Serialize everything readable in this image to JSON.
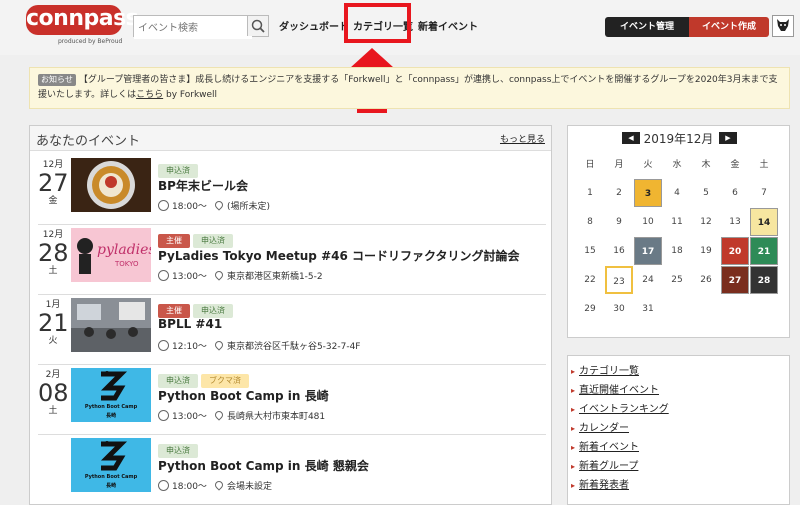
{
  "header": {
    "logo_text": "connpass",
    "logo_sub": "produced by BeProud",
    "search_placeholder": "イベント検索",
    "nav": [
      "ダッシュボード",
      "カテゴリ一覧",
      "新着イベント"
    ],
    "manage_button": "イベント管理",
    "create_button": "イベント作成"
  },
  "notice": {
    "badge": "お知らせ",
    "text": "【グループ管理者の皆さま】成長し続けるエンジニアを支援する「Forkwell」と「connpass」が連携し、connpass上でイベントを開催するグループを2020年3月末まで支援いたします。詳しくは",
    "link": "こちら",
    "suffix": " by Forkwell"
  },
  "events_panel": {
    "title": "あなたのイベント",
    "more": "もっと見る",
    "events": [
      {
        "month": "12月",
        "day": "27",
        "weekday": "金",
        "badges": [
          "申込済"
        ],
        "title": "BP年末ビール会",
        "time": "18:00〜",
        "place": "(場所未定)"
      },
      {
        "month": "12月",
        "day": "28",
        "weekday": "土",
        "badges": [
          "主催",
          "申込済"
        ],
        "title": "PyLadies Tokyo Meetup #46 コードリファクタリング討論会",
        "time": "13:00〜",
        "place": "東京都港区東新橋1-5-2"
      },
      {
        "month": "1月",
        "day": "21",
        "weekday": "火",
        "badges": [
          "主催",
          "申込済"
        ],
        "title": "BPLL #41",
        "time": "12:10〜",
        "place": "東京都渋谷区千駄ヶ谷5-32-7-4F"
      },
      {
        "month": "2月",
        "day": "08",
        "weekday": "土",
        "badges": [
          "申込済",
          "ブクマ済"
        ],
        "title": "Python Boot Camp in 長崎",
        "time": "13:00〜",
        "place": "長崎県大村市東本町481"
      },
      {
        "month": "",
        "day": "",
        "weekday": "",
        "badges": [
          "申込済"
        ],
        "title": "Python Boot Camp in 長崎 懇親会",
        "time": "18:00〜",
        "place": "会場未設定"
      }
    ],
    "thumb_texts": {
      "pyladies": "pyladies",
      "pyladies_sub": "TOKYO",
      "pbc": "Python Boot Camp",
      "pbc_sub": "長崎"
    }
  },
  "calendar": {
    "title": "2019年12月",
    "prev": "◀",
    "next": "▶",
    "weekdays": [
      "日",
      "月",
      "火",
      "水",
      "木",
      "金",
      "土"
    ],
    "weeks": [
      [
        "1",
        "2",
        "3",
        "4",
        "5",
        "6",
        "7"
      ],
      [
        "8",
        "9",
        "10",
        "11",
        "12",
        "13",
        "14"
      ],
      [
        "15",
        "16",
        "17",
        "18",
        "19",
        "20",
        "21"
      ],
      [
        "22",
        "23",
        "24",
        "25",
        "26",
        "27",
        "28"
      ],
      [
        "29",
        "30",
        "31",
        "",
        "",
        "",
        ""
      ]
    ],
    "event_days": [
      "3",
      "14",
      "17",
      "20",
      "21",
      "27",
      "28"
    ],
    "today": "23"
  },
  "links": [
    "カテゴリ一覧",
    "直近開催イベント",
    "イベントランキング",
    "カレンダー",
    "新着イベント",
    "新着グループ",
    "新着発表者"
  ],
  "colors": {
    "brand": "#c9302a",
    "highlight": "#e8161e",
    "applied": "#dce9d6",
    "host": "#c9574a",
    "bookmark": "#fde6a8"
  }
}
